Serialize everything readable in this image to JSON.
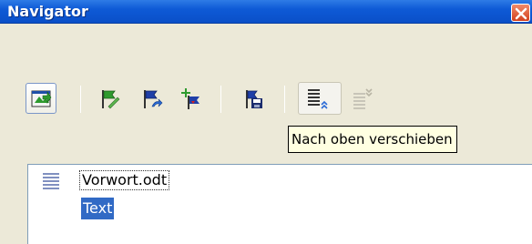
{
  "window": {
    "title": "Navigator"
  },
  "toolbar": {
    "buttons": [
      {
        "name": "toggle-navigation-icon",
        "state": "active"
      },
      {
        "name": "flag-edit-icon"
      },
      {
        "name": "flag-link-icon"
      },
      {
        "name": "flag-insert-icon"
      },
      {
        "name": "flag-save-icon"
      },
      {
        "name": "move-up-icon",
        "state": "hover"
      },
      {
        "name": "move-down-icon",
        "state": "disabled"
      }
    ],
    "tooltip": "Nach oben verschieben"
  },
  "tree": {
    "items": [
      {
        "label": "Vorwort.odt",
        "icon": "document-lines-icon"
      },
      {
        "label": "Text",
        "selected": true
      }
    ]
  },
  "colors": {
    "titlebar": "#0a4fc8",
    "selection": "#316ac5",
    "tooltip_bg": "#ffffe1",
    "flag_green": "#2e9a2e",
    "flag_blue": "#1f3fa8"
  }
}
